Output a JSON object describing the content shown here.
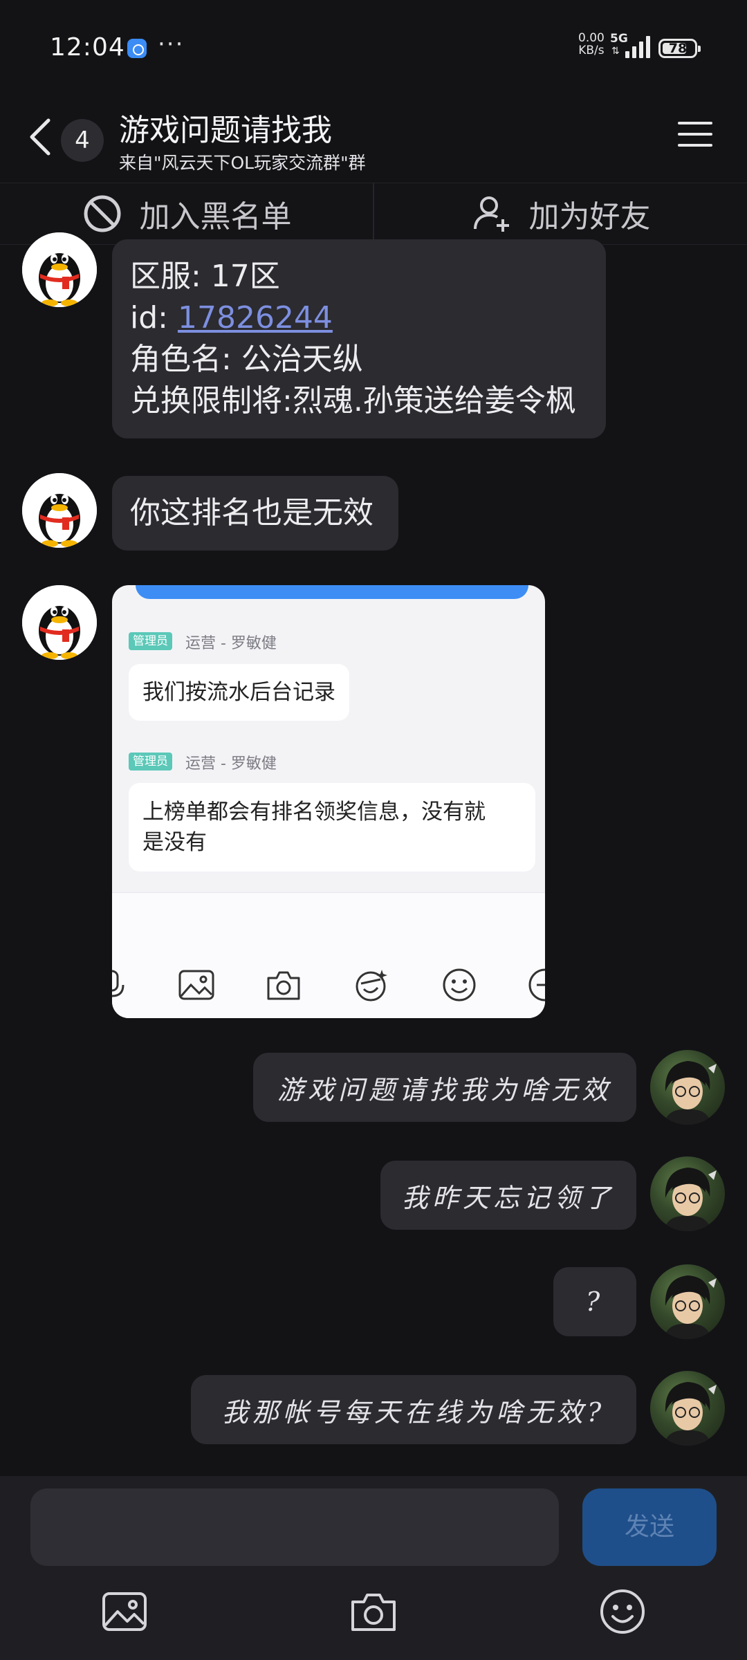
{
  "status": {
    "time": "12:04",
    "speed_value": "0.00",
    "speed_unit": "KB/s",
    "network": "5G",
    "battery": "78",
    "battery_level": 0.78
  },
  "header": {
    "badge": "4",
    "title": "游戏问题请找我",
    "subtitle": "来自\"风云天下OL玩家交流群\"群"
  },
  "actions": {
    "blacklist": "加入黑名单",
    "add_friend": "加为好友"
  },
  "messages": {
    "first": {
      "line1": "区服: 17区",
      "id_prefix": "id: ",
      "id_value": "17826244",
      "line3": "角色名: 公治天纵",
      "line4": "兑换限制将:烈魂.孙策送给姜令枫"
    },
    "second": "你这排名也是无效",
    "screenshot": {
      "tag": "管理员",
      "sender": "运营 - 罗敏健",
      "msg1": "我们按流水后台记录",
      "msg2_line1": "上榜单都会有排名领奖信息，没有就",
      "msg2_line2": "是没有"
    },
    "out1": "游戏问题请找我为啥无效",
    "out2": "我昨天忘记领了",
    "out3": "?",
    "out4": "我那帐号每天在线为啥无效?"
  },
  "composer": {
    "send": "发送"
  },
  "colors": {
    "accent": "#3d8df5",
    "send_bg": "#1f4f8a",
    "link": "#7d8fe0"
  }
}
